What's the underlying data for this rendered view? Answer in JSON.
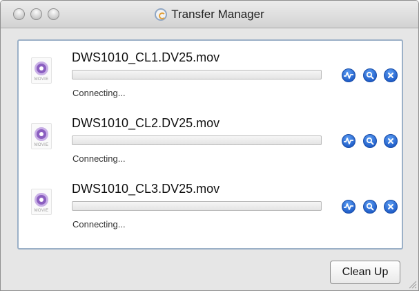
{
  "window": {
    "title": "Transfer Manager",
    "app_icon": "transfer-manager-icon"
  },
  "transfers": [
    {
      "file_name": "DWS1010_CL1.DV25.mov",
      "status": "Connecting...",
      "progress": 0,
      "icon": "quicktime-movie-icon",
      "icon_tag": "MOVIE"
    },
    {
      "file_name": "DWS1010_CL2.DV25.mov",
      "status": "Connecting...",
      "progress": 0,
      "icon": "quicktime-movie-icon",
      "icon_tag": "MOVIE"
    },
    {
      "file_name": "DWS1010_CL3.DV25.mov",
      "status": "Connecting...",
      "progress": 0,
      "icon": "quicktime-movie-icon",
      "icon_tag": "MOVIE"
    }
  ],
  "row_actions": {
    "activity_icon": "activity-icon",
    "inspect_icon": "magnifier-icon",
    "cancel_icon": "close-icon"
  },
  "footer": {
    "cleanup_label": "Clean Up"
  },
  "colors": {
    "action_button": "#2a6fd6",
    "panel_border": "#9bb0c7",
    "movie_icon": "#8b5fc0"
  }
}
